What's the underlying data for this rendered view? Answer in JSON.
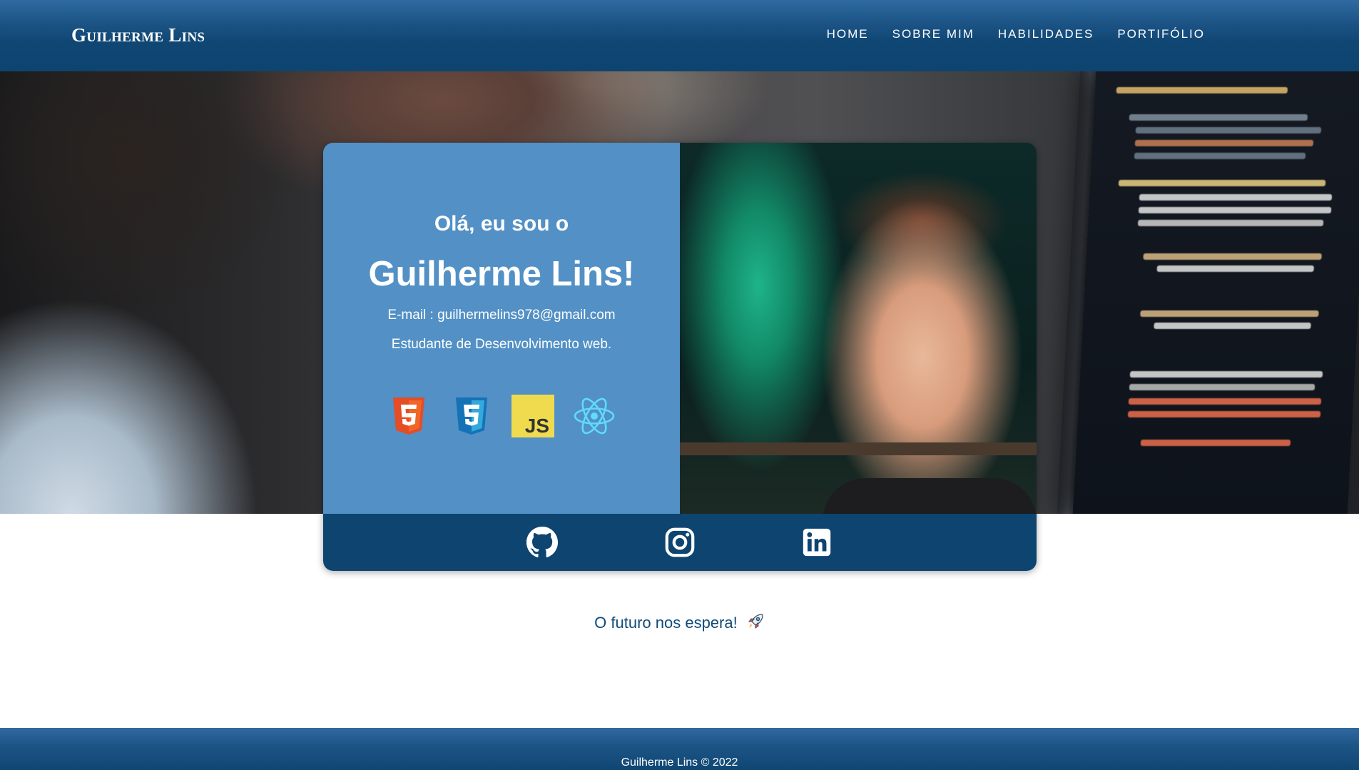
{
  "header": {
    "brand": "Guilherme Lins",
    "nav": [
      "HOME",
      "SOBRE MIM",
      "HABILIDADES",
      "PORTIFÓLIO"
    ]
  },
  "hero": {
    "greeting": "Olá, eu sou o",
    "name": "Guilherme Lins!",
    "email": "E-mail : guilhermelins978@gmail.com",
    "role": "Estudante de Desenvolvimento web.",
    "tech_icons": [
      "html5-icon",
      "css3-icon",
      "javascript-icon",
      "react-icon"
    ],
    "social_icons": [
      "github-icon",
      "instagram-icon",
      "linkedin-icon"
    ]
  },
  "tagline": "O futuro nos espera!",
  "footer": {
    "text": "Guilherme Lins © 2022"
  },
  "colors": {
    "header": "#0e4470",
    "card_left": "#5290c5",
    "card_bottom": "#0e4470",
    "tagline": "#114a78",
    "html5": "#e44d26",
    "css3": "#1572b6",
    "js": "#f0db4f",
    "react": "#61dafb"
  }
}
